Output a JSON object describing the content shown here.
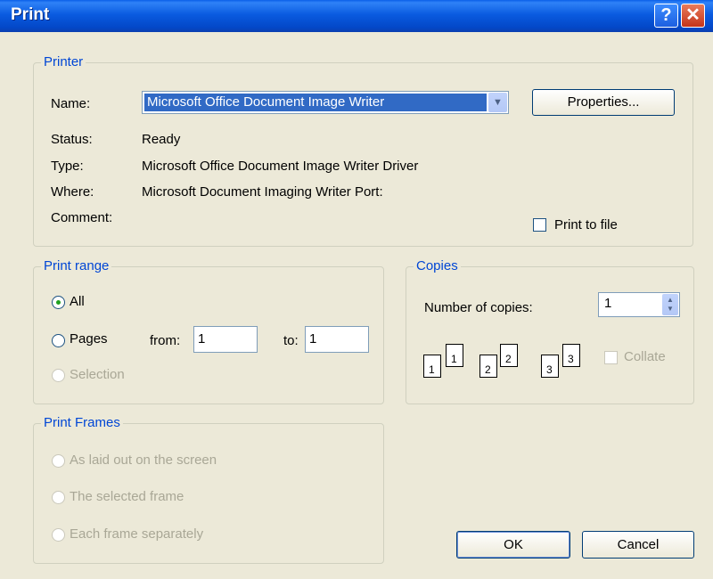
{
  "window": {
    "title": "Print",
    "help_glyph": "?",
    "close_glyph": "✕"
  },
  "printer": {
    "group_label": "Printer",
    "name_label": "Name:",
    "name_value": "Microsoft Office Document Image Writer",
    "properties_button": "Properties...",
    "status_label": "Status:",
    "status_value": "Ready",
    "type_label": "Type:",
    "type_value": "Microsoft Office Document Image Writer Driver",
    "where_label": "Where:",
    "where_value": "Microsoft Document Imaging Writer Port:",
    "comment_label": "Comment:",
    "comment_value": "",
    "print_to_file_label": "Print to file",
    "print_to_file_checked": false
  },
  "print_range": {
    "group_label": "Print range",
    "all_label": "All",
    "pages_label": "Pages",
    "from_label": "from:",
    "from_value": "1",
    "to_label": "to:",
    "to_value": "1",
    "selection_label": "Selection",
    "selected": "All"
  },
  "copies": {
    "group_label": "Copies",
    "number_label": "Number of copies:",
    "number_value": "1",
    "collate_label": "Collate",
    "collate_checked": false,
    "collate_pages": [
      "1",
      "1",
      "2",
      "2",
      "3",
      "3"
    ]
  },
  "print_frames": {
    "group_label": "Print Frames",
    "option1": "As laid out on the screen",
    "option2": "The selected frame",
    "option3": "Each frame separately"
  },
  "buttons": {
    "ok": "OK",
    "cancel": "Cancel"
  },
  "colors": {
    "dialog_bg": "#ece9d8",
    "title_bar": "#0a5be0",
    "group_label": "#0046d5",
    "selection_highlight": "#316ac5"
  }
}
